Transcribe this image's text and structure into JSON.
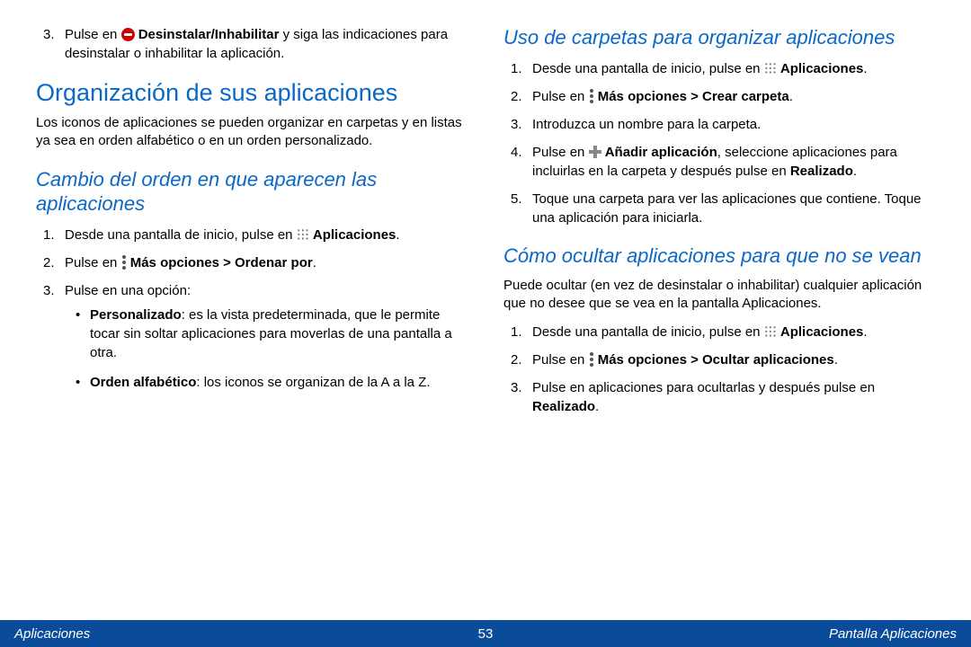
{
  "left": {
    "step3": {
      "num": "3.",
      "t1": "Pulse en ",
      "bold1": "Desinstalar/Inhabilitar",
      "t2": " y siga las indicaciones para desinstalar o inhabilitar la aplicación."
    },
    "h1": "Organización de sus aplicaciones",
    "intro": "Los iconos de aplicaciones se pueden organizar en carpetas y en listas ya sea en orden alfabético o en un orden personalizado.",
    "h2": "Cambio del orden en que aparecen las aplicaciones",
    "steps": {
      "s1": {
        "num": "1.",
        "t1": "Desde una pantalla de inicio, pulse en ",
        "bold": "Aplicaciones",
        "t2": "."
      },
      "s2": {
        "num": "2.",
        "t1": "Pulse en ",
        "bold": "Más opciones > Ordenar por",
        "t2": "."
      },
      "s3": {
        "num": "3.",
        "t1": "Pulse en una opción:"
      }
    },
    "bullets": {
      "b1": {
        "bold": "Personalizado",
        "t": ": es la vista predeterminada, que le permite tocar sin soltar aplicaciones para moverlas de una pantalla a otra."
      },
      "b2": {
        "bold": "Orden alfabético",
        "t": ": los iconos se organizan de la A a la Z."
      }
    }
  },
  "right": {
    "h2a": "Uso de carpetas para organizar aplicaciones",
    "stepsA": {
      "s1": {
        "num": "1.",
        "t1": "Desde una pantalla de inicio, pulse en ",
        "bold": "Aplicaciones",
        "t2": "."
      },
      "s2": {
        "num": "2.",
        "t1": "Pulse en ",
        "bold": "Más opciones > Crear carpeta",
        "t2": "."
      },
      "s3": {
        "num": "3.",
        "t1": "Introduzca un nombre para la carpeta."
      },
      "s4": {
        "num": "4.",
        "t1": "Pulse en ",
        "bold": "Añadir aplicación",
        "t2": ", seleccione aplicaciones para incluirlas en la carpeta y después pulse en ",
        "bold2": "Realizado",
        "t3": "."
      },
      "s5": {
        "num": "5.",
        "t1": "Toque una carpeta para ver las aplicaciones que contiene. Toque una aplicación para iniciarla."
      }
    },
    "h2b": "Cómo ocultar aplicaciones para que no se vean",
    "introB": "Puede ocultar (en vez de desinstalar o inhabilitar) cualquier aplicación que no desee que se vea en la pantalla Aplicaciones.",
    "stepsB": {
      "s1": {
        "num": "1.",
        "t1": "Desde una pantalla de inicio, pulse en ",
        "bold": "Aplicaciones",
        "t2": "."
      },
      "s2": {
        "num": "2.",
        "t1": "Pulse en ",
        "bold": "Más opciones > Ocultar aplicaciones",
        "t2": "."
      },
      "s3": {
        "num": "3.",
        "t1": "Pulse en aplicaciones para ocultarlas y después pulse en ",
        "bold": "Realizado",
        "t2": "."
      }
    }
  },
  "footer": {
    "left": "Aplicaciones",
    "center": "53",
    "right": "Pantalla Aplicaciones"
  }
}
